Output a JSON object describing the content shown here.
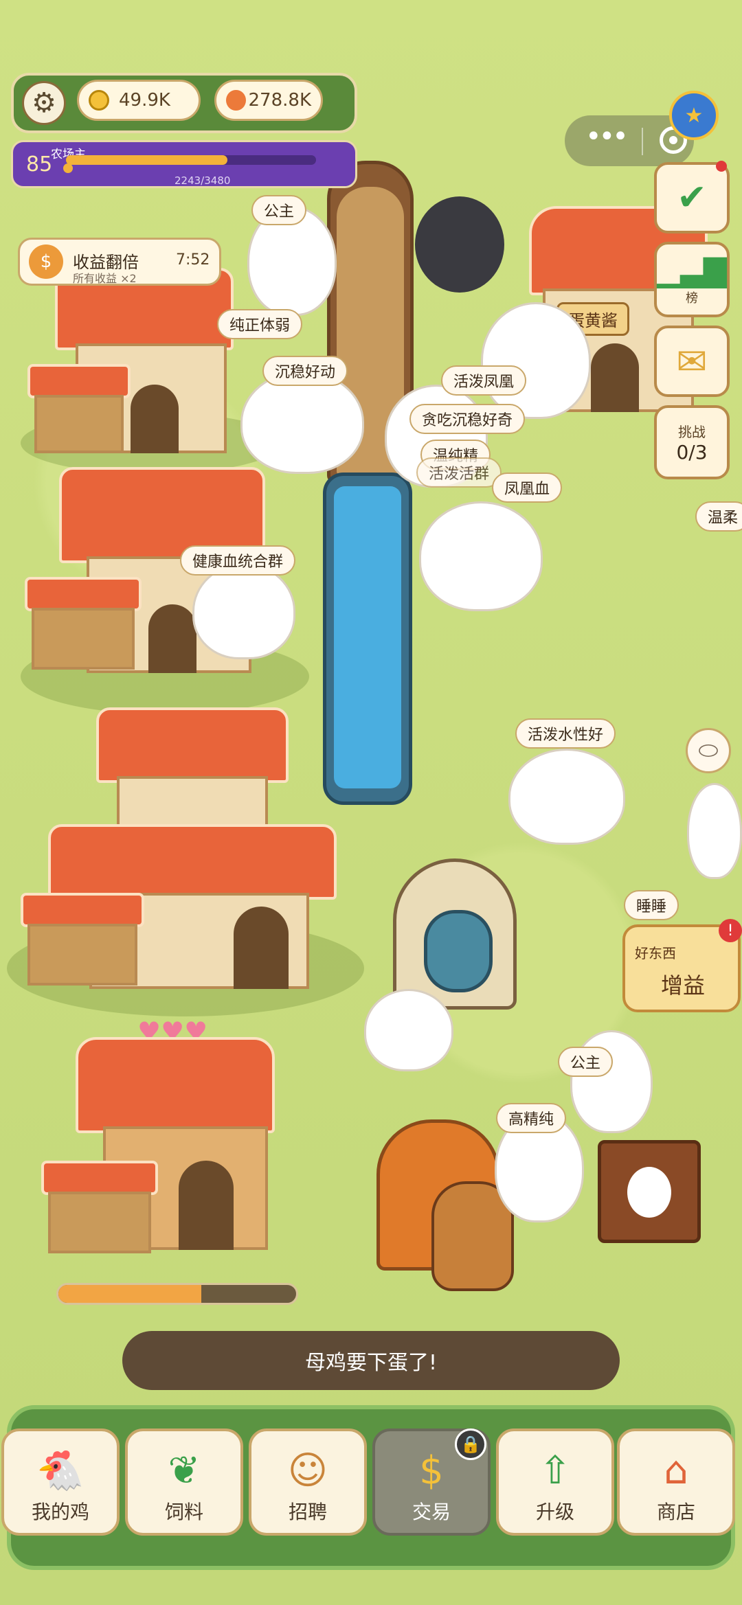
{
  "hud": {
    "coins": "49.9K",
    "gems": "278.8K",
    "level": "85",
    "level_title": "农场主",
    "xp": "2243/3480",
    "xp_progress": 0.645
  },
  "boost": {
    "title": "收益翻倍",
    "subtitle": "所有收益 ×2",
    "timer": "7:52",
    "icon": "$"
  },
  "side": {
    "rank_label": "榜",
    "challenge_label": "挑战",
    "challenge_count": "0/3"
  },
  "bonus_card": {
    "title": "好东西",
    "action": "增益",
    "badge": "!"
  },
  "signs": {
    "shop_sign": "蛋黄酱"
  },
  "chicken_labels": [
    "公主",
    "纯正体弱",
    "沉稳好动",
    "活泼凤凰",
    "贪吃沉稳好奇",
    "温纯精",
    "活泼活群",
    "凤凰血",
    "健康血统合群",
    "活泼水性好",
    "温柔",
    "睡睡",
    "公主",
    "高精纯"
  ],
  "egg_progress": 0.6,
  "status_message": "母鸡要下蛋了!",
  "nav": [
    {
      "label": "我的鸡",
      "icon": "chicken-icon"
    },
    {
      "label": "饲料",
      "icon": "leaf-icon"
    },
    {
      "label": "招聘",
      "icon": "badge-icon"
    },
    {
      "label": "交易",
      "icon": "market-icon"
    },
    {
      "label": "升级",
      "icon": "arrow-up-icon"
    },
    {
      "label": "商店",
      "icon": "shop-icon"
    }
  ],
  "colors": {
    "grass": "#c8db7c",
    "accent": "#f3b23a",
    "nav_green": "#5b9442"
  }
}
